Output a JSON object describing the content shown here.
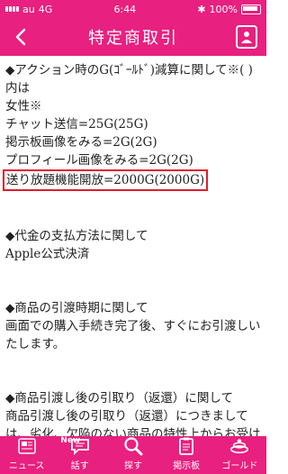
{
  "statusbar": {
    "carrier": "au",
    "network": "4G",
    "time": "6:44",
    "battery": "100%"
  },
  "header": {
    "title": "特定商取引"
  },
  "content": {
    "lines": [
      "◆アクション時のG(ｺﾞｰﾙﾄﾞ)減算に関して※( )内は",
      "女性※",
      "チャット送信=25G(25G)",
      "掲示板画像をみる=2G(2G)",
      "プロフィール画像をみる=2G(2G)"
    ],
    "highlight": "送り放題機能開放=2000G(2000G)",
    "payment_heading": "◆代金の支払方法に関して",
    "payment_method": "Apple公式決済",
    "delivery_heading": "◆商品の引渡時期に関して",
    "delivery_text": "画面での購入手続き完了後、すぐにお引渡しいたします。",
    "return_heading": "◆商品引渡し後の引取り（返還）に関して",
    "return_text": "商品引渡し後の引取り（返還）につきましては、劣化、欠陥のない商品の特性上からお受けすることができません。"
  },
  "tabbar": {
    "items": [
      {
        "label": "ニュース",
        "icon": "news-icon"
      },
      {
        "label": "話す",
        "icon": "chat-icon",
        "badge": "New"
      },
      {
        "label": "探す",
        "icon": "search-icon"
      },
      {
        "label": "掲示板",
        "icon": "board-icon"
      },
      {
        "label": "ゴールド",
        "icon": "gold-icon"
      }
    ]
  }
}
